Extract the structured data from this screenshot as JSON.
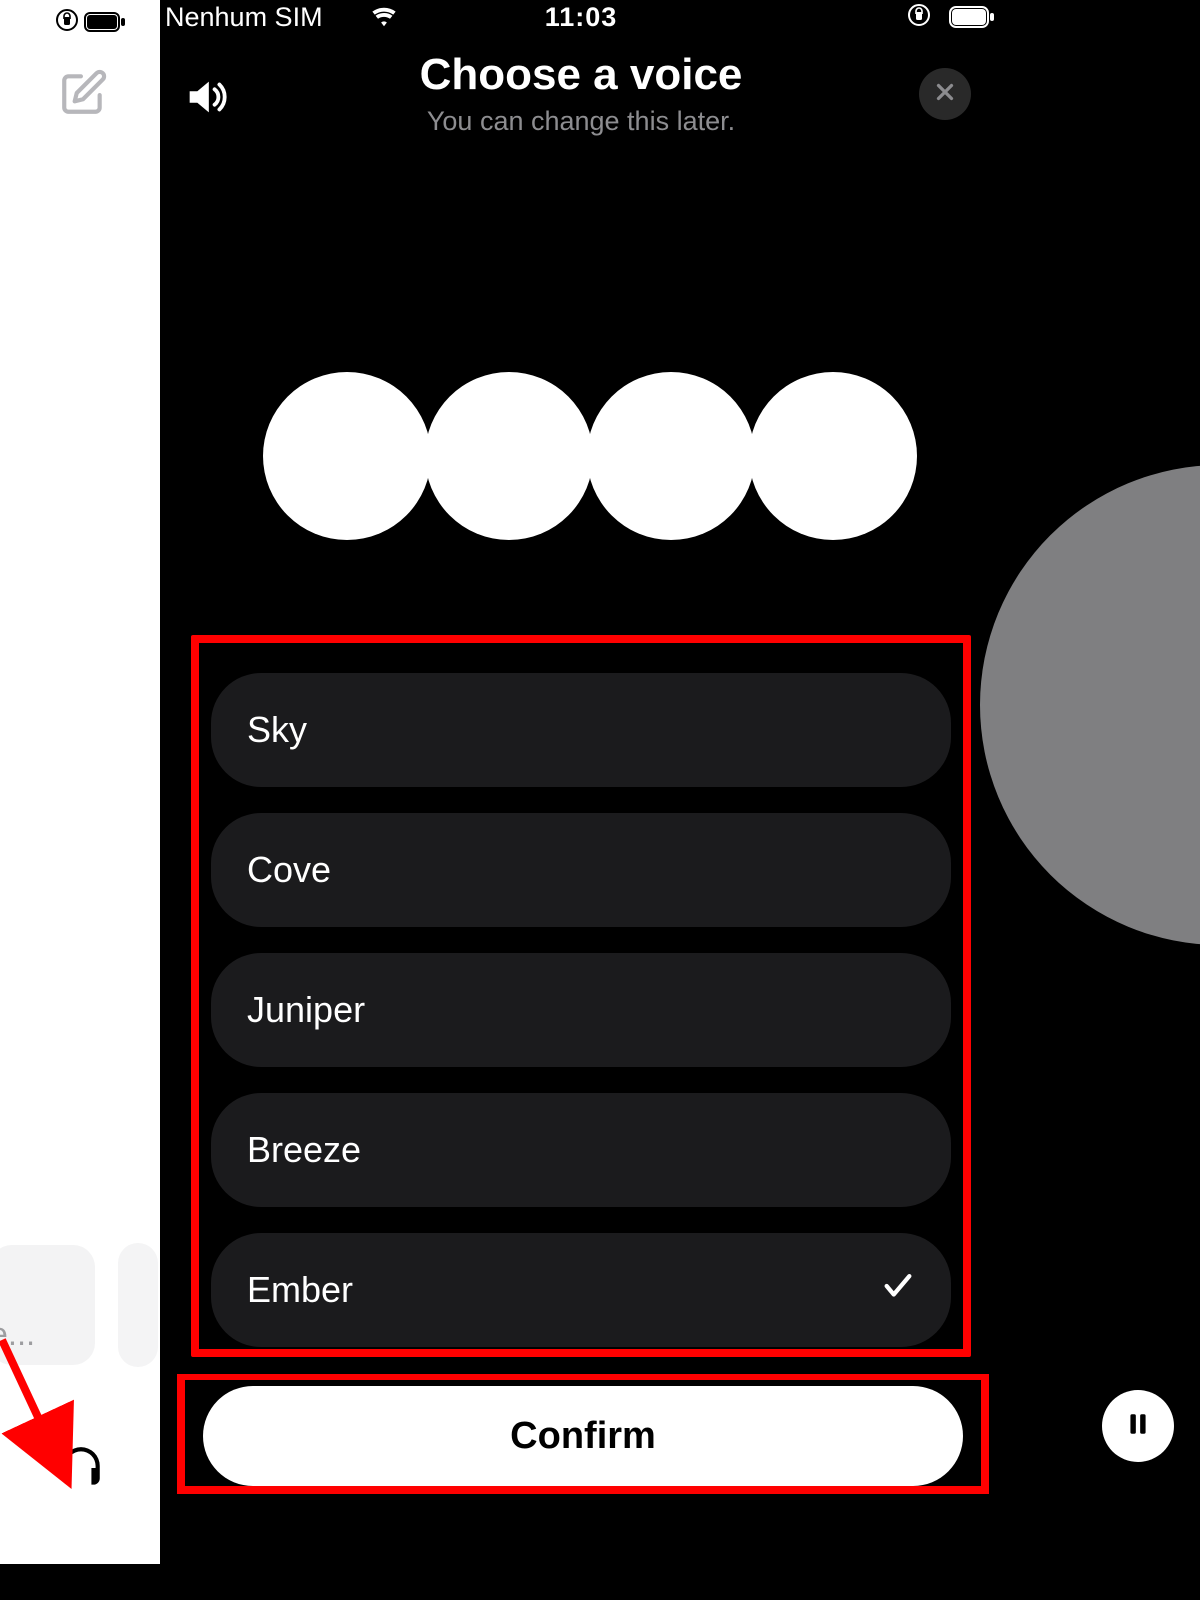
{
  "status": {
    "sim": "Nenhum SIM",
    "time": "11:03"
  },
  "bgLeft": {
    "messagePlaceholder": "e..."
  },
  "header": {
    "title": "Choose a voice",
    "subtitle": "You can change this later."
  },
  "voices": [
    {
      "label": "Sky",
      "selected": false
    },
    {
      "label": "Cove",
      "selected": false
    },
    {
      "label": "Juniper",
      "selected": false
    },
    {
      "label": "Breeze",
      "selected": false
    },
    {
      "label": "Ember",
      "selected": true
    }
  ],
  "confirm": {
    "label": "Confirm"
  }
}
